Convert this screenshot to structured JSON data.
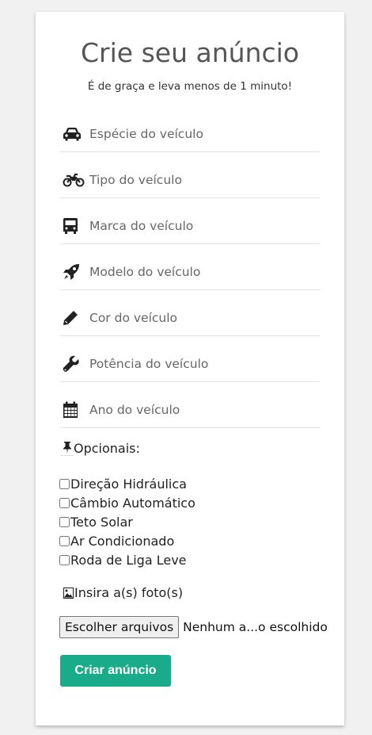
{
  "form": {
    "title": "Crie seu anúncio",
    "subtitle": "É de graça e leva menos de 1 minuto!",
    "fields": [
      {
        "icon": "car-icon",
        "placeholder": "Espécie do veículo"
      },
      {
        "icon": "motorcycle-icon",
        "placeholder": "Tipo do veículo"
      },
      {
        "icon": "bus-icon",
        "placeholder": "Marca do veículo"
      },
      {
        "icon": "rocket-icon",
        "placeholder": "Modelo do veículo"
      },
      {
        "icon": "pencil-icon",
        "placeholder": "Cor do veículo"
      },
      {
        "icon": "wrench-icon",
        "placeholder": "Potência do veículo"
      },
      {
        "icon": "calendar-icon",
        "placeholder": "Ano do veículo"
      }
    ],
    "optionals_label": "Opcionais:",
    "optionals": [
      "Direção Hidráulica",
      "Câmbio Automático",
      "Teto Solar",
      "Ar Condicionado",
      "Roda de Liga Leve"
    ],
    "photo_label": "Insira a(s) foto(s)",
    "file_button": "Escolher arquivos",
    "file_status": "Nenhum a...o escolhido",
    "submit_label": "Criar anúncio"
  },
  "colors": {
    "accent": "#1aab8a",
    "background": "#f1f1f1",
    "card": "#ffffff"
  }
}
